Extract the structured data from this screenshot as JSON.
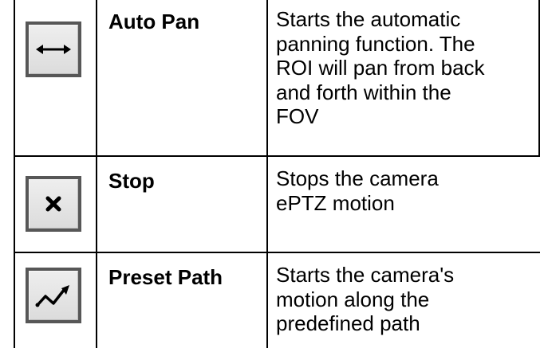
{
  "rows": [
    {
      "icon": "left-right-arrow-icon",
      "name": "Auto Pan",
      "description_lines": [
        "Starts the automatic",
        "panning function. The",
        "ROI will pan from back",
        "and forth within the",
        "FOV"
      ]
    },
    {
      "icon": "close-x-icon",
      "name": "Stop",
      "description_lines": [
        "Stops the camera",
        "ePTZ motion"
      ]
    },
    {
      "icon": "zigzag-path-icon",
      "name": "Preset Path",
      "description_lines": [
        "Starts the camera's",
        "motion along the",
        "predefined path"
      ]
    }
  ]
}
